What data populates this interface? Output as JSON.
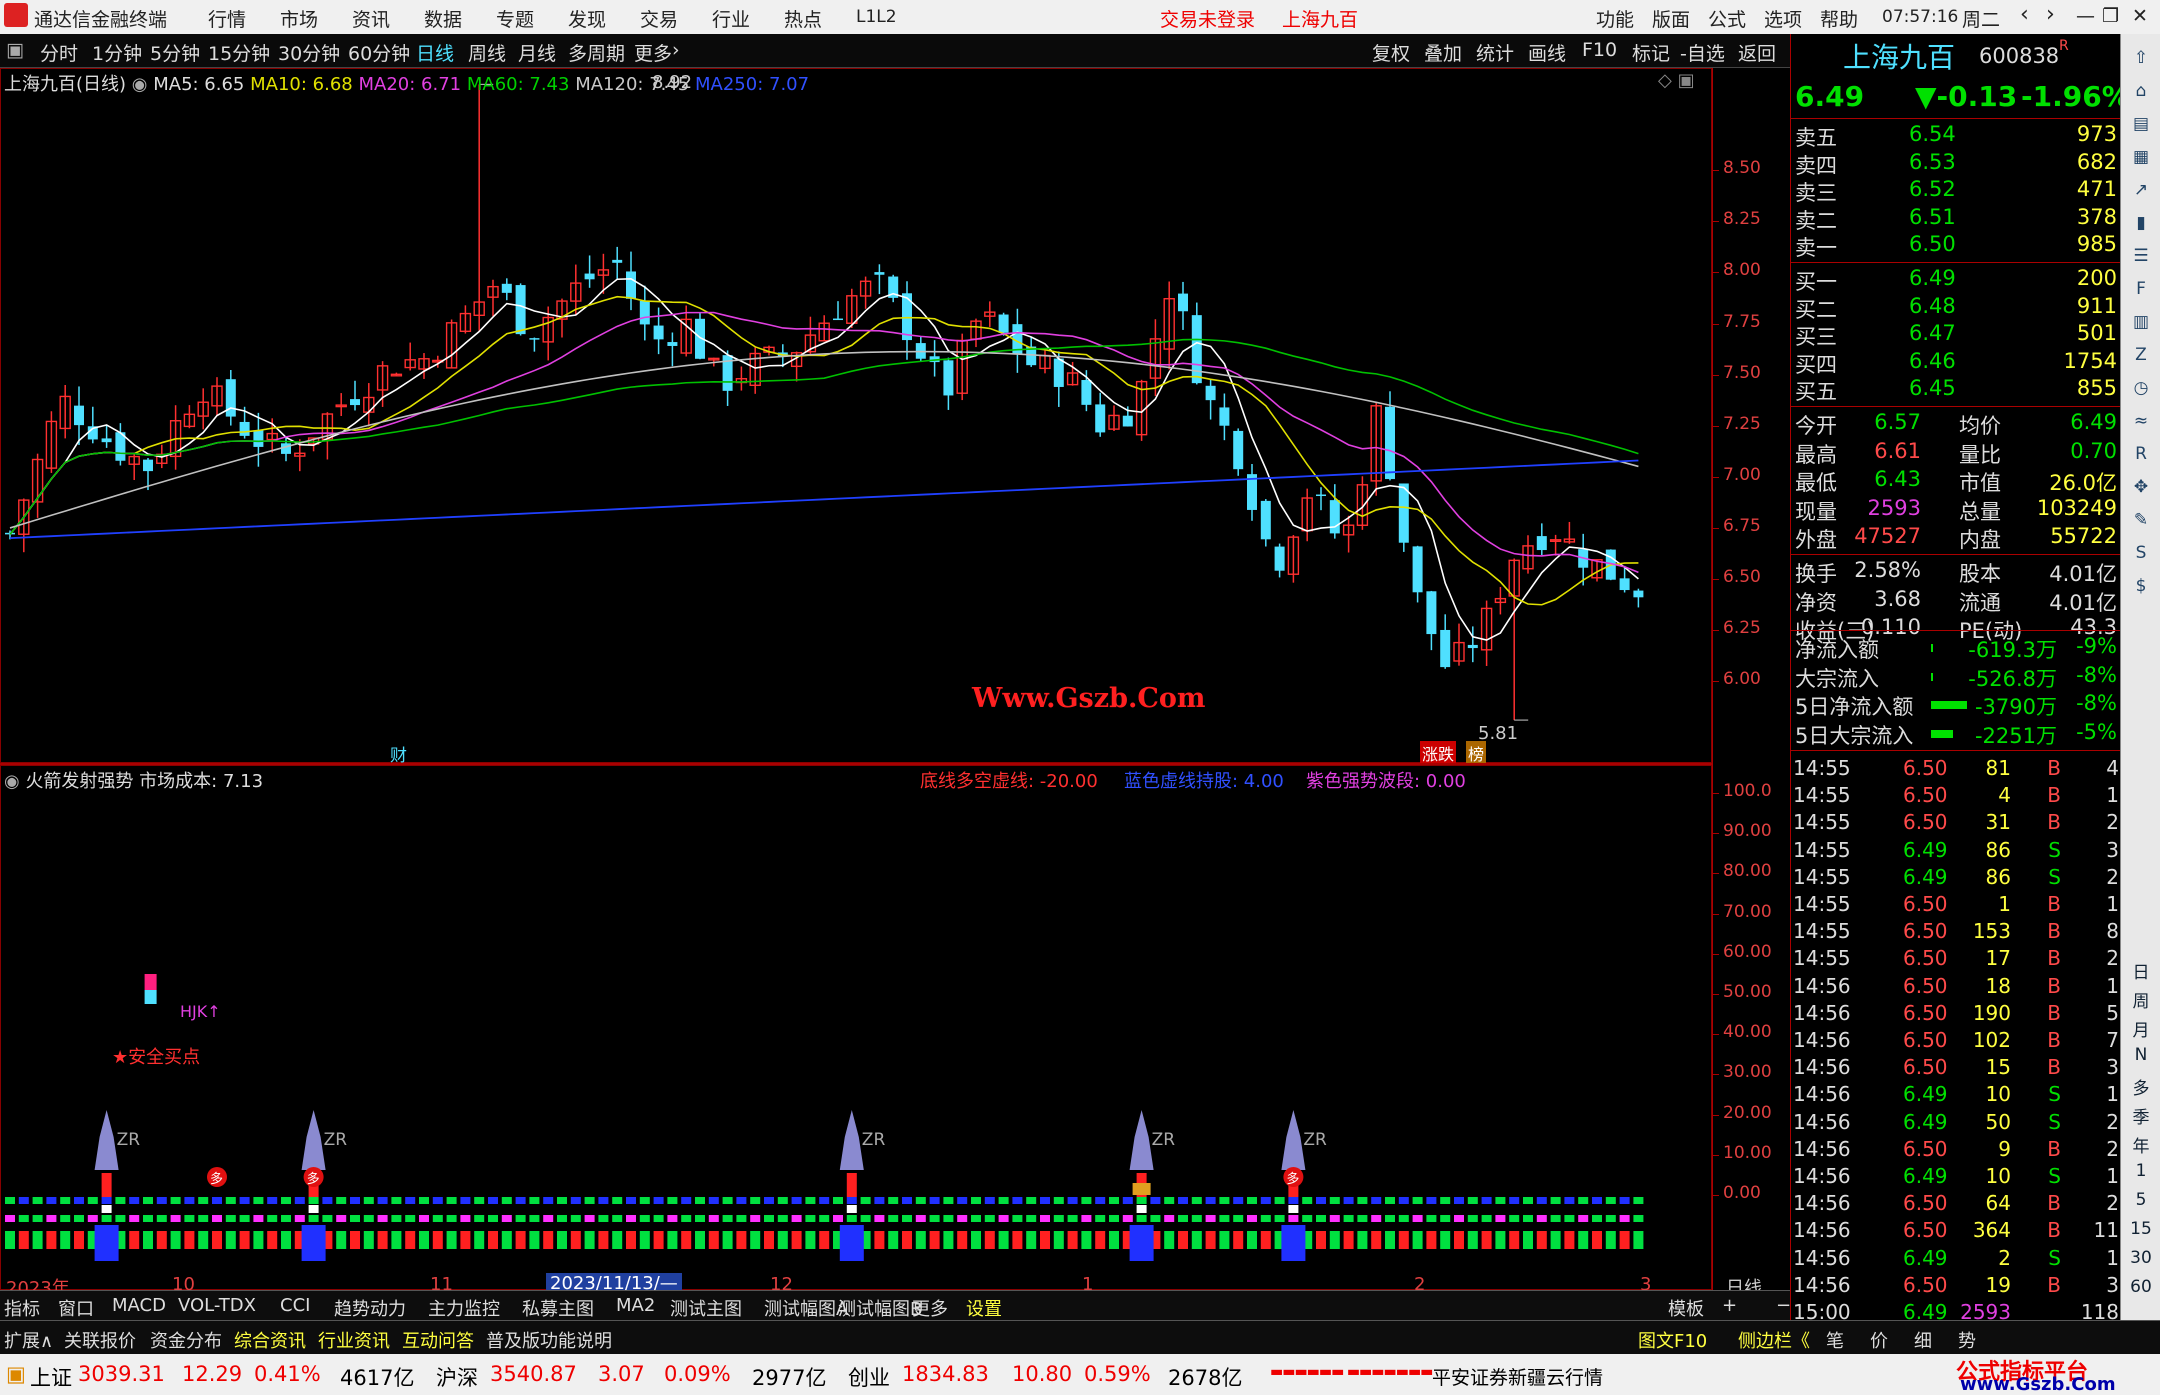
{
  "app": {
    "title": "通达信金融终端",
    "status_center": "交易未登录",
    "stock_center": "上海九百",
    "menu": [
      "行情",
      "市场",
      "资讯",
      "数据",
      "专题",
      "发现",
      "交易",
      "行业",
      "热点",
      "L1L2"
    ],
    "right_menu": [
      "功能",
      "版面",
      "公式",
      "选项",
      "帮助"
    ],
    "clock": "07:57:16",
    "weekday": "周二"
  },
  "periods": [
    "分时",
    "1分钟",
    "5分钟",
    "15分钟",
    "30分钟",
    "60分钟",
    "日线",
    "周线",
    "月线",
    "多周期",
    "更多"
  ],
  "active_period": "日线",
  "toolbar_right": [
    "复权",
    "叠加",
    "统计",
    "画线",
    "F10",
    "标记",
    "-自选",
    "返回"
  ],
  "legend": {
    "label": "上海九百(日线)",
    "ma5": "MA5: 6.65",
    "ma10": "MA10: 6.68",
    "ma20": "MA20: 6.71",
    "ma60": "MA60: 7.43",
    "ma120": "MA120: 7.45",
    "ma250": "MA250: 7.07"
  },
  "annotations": {
    "high": "8.92",
    "low": "5.81",
    "cai": "财",
    "zd": "涨跌",
    "bang": "榜",
    "watermark": "Www.Gszb.Com"
  },
  "indicator": {
    "name": "火箭发射强势",
    "cost": "市场成本: 7.13",
    "line1": "底线多空虚线: -20.00",
    "line2": "蓝色虚线持股: 4.00",
    "line3": "紫色强势波段: 0.00",
    "buy": "★安全买点",
    "kjk": "HJK↑",
    "zr": "ZR",
    "duo": "多"
  },
  "price_axis": [
    "8.50",
    "8.25",
    "8.00",
    "7.75",
    "7.50",
    "7.25",
    "7.00",
    "6.75",
    "6.50",
    "6.25",
    "6.00"
  ],
  "ind_axis": [
    "100.0",
    "90.00",
    "80.00",
    "70.00",
    "60.00",
    "50.00",
    "40.00",
    "30.00",
    "20.00",
    "10.00",
    "0.00"
  ],
  "date_axis": {
    "y2023": "2023年",
    "m10": "10",
    "m11": "11",
    "cursor": "2023/11/13/—",
    "m12": "12",
    "m1": "1",
    "m2": "2",
    "m3": "3",
    "period": "日线"
  },
  "quote": {
    "name": "上海九百",
    "code": "600838",
    "tag": "R",
    "price": "6.49",
    "change": "▼-0.13",
    "pct": "-1.96%",
    "asks": [
      [
        "卖五",
        "6.54",
        "973"
      ],
      [
        "卖四",
        "6.53",
        "682"
      ],
      [
        "卖三",
        "6.52",
        "471"
      ],
      [
        "卖二",
        "6.51",
        "378"
      ],
      [
        "卖一",
        "6.50",
        "985"
      ]
    ],
    "bids": [
      [
        "买一",
        "6.49",
        "200"
      ],
      [
        "买二",
        "6.48",
        "911"
      ],
      [
        "买三",
        "6.47",
        "501"
      ],
      [
        "买四",
        "6.46",
        "1754"
      ],
      [
        "买五",
        "6.45",
        "855"
      ]
    ],
    "stats": [
      [
        "今开",
        "6.57",
        "均价",
        "6.49"
      ],
      [
        "最高",
        "6.61",
        "量比",
        "0.70"
      ],
      [
        "最低",
        "6.43",
        "市值",
        "26.0亿"
      ],
      [
        "现量",
        "2593",
        "总量",
        "103249"
      ],
      [
        "外盘",
        "47527",
        "内盘",
        "55722"
      ]
    ],
    "stats2": [
      [
        "换手",
        "2.58%",
        "股本",
        "4.01亿"
      ],
      [
        "净资",
        "3.68",
        "流通",
        "4.01亿"
      ],
      [
        "收益(三)",
        "0.110",
        "PE(动)",
        "43.3"
      ]
    ],
    "flows": [
      [
        "净流入额",
        "-619.3万",
        "-9%"
      ],
      [
        "大宗流入",
        "-526.8万",
        "-8%"
      ],
      [
        "5日净流入额",
        "-3790万",
        "-8%"
      ],
      [
        "5日大宗流入",
        "-2251万",
        "-5%"
      ]
    ],
    "ticks": [
      [
        "14:55",
        "6.50",
        "81",
        "B",
        "4"
      ],
      [
        "14:55",
        "6.50",
        "4",
        "B",
        "1"
      ],
      [
        "14:55",
        "6.50",
        "31",
        "B",
        "2"
      ],
      [
        "14:55",
        "6.49",
        "86",
        "S",
        "3"
      ],
      [
        "14:55",
        "6.49",
        "86",
        "S",
        "2"
      ],
      [
        "14:55",
        "6.50",
        "1",
        "B",
        "1"
      ],
      [
        "14:55",
        "6.50",
        "153",
        "B",
        "8"
      ],
      [
        "14:55",
        "6.50",
        "17",
        "B",
        "2"
      ],
      [
        "14:56",
        "6.50",
        "18",
        "B",
        "1"
      ],
      [
        "14:56",
        "6.50",
        "190",
        "B",
        "5"
      ],
      [
        "14:56",
        "6.50",
        "102",
        "B",
        "7"
      ],
      [
        "14:56",
        "6.50",
        "15",
        "B",
        "3"
      ],
      [
        "14:56",
        "6.49",
        "10",
        "S",
        "1"
      ],
      [
        "14:56",
        "6.49",
        "50",
        "S",
        "2"
      ],
      [
        "14:56",
        "6.50",
        "9",
        "B",
        "2"
      ],
      [
        "14:56",
        "6.49",
        "10",
        "S",
        "1"
      ],
      [
        "14:56",
        "6.50",
        "64",
        "B",
        "2"
      ],
      [
        "14:56",
        "6.50",
        "364",
        "B",
        "11"
      ],
      [
        "14:56",
        "6.49",
        "2",
        "S",
        "1"
      ],
      [
        "14:56",
        "6.50",
        "19",
        "B",
        "3"
      ],
      [
        "15:00",
        "6.49",
        "2593",
        "",
        "118"
      ]
    ]
  },
  "bottom_tabs": [
    "指标",
    "窗口",
    "MACD",
    "VOL-TDX",
    "CCI",
    "趋势动力",
    "主力监控",
    "私募主图",
    "MA2",
    "测试主图",
    "测试幅图A",
    "测试幅图B",
    "更多",
    "设置"
  ],
  "bottom_right": [
    "模板",
    "+",
    "−"
  ],
  "bottom_tabs2": [
    "扩展∧",
    "关联报价",
    "资金分布",
    "综合资讯",
    "行业资讯",
    "互动问答",
    "普及版功能说明"
  ],
  "bottom2_right": [
    "图文F10",
    "侧边栏《",
    "笔",
    "价",
    "细",
    "势"
  ],
  "statusbar": {
    "sh_label": "上证",
    "sh": "3039.31",
    "sh_chg": "12.29",
    "sh_pct": "0.41%",
    "sh_amt": "4617亿",
    "hs_label": "沪深",
    "hs": "3540.87",
    "hs_chg": "3.07",
    "hs_pct": "0.09%",
    "hs_amt": "2977亿",
    "cy_label": "创业",
    "cy": "1834.83",
    "cy_chg": "10.80",
    "cy_pct": "0.59%",
    "cy_amt": "2678亿",
    "broker": "平安证券新疆云行情",
    "brand": "公式指标平台",
    "brand_url": "www.Gszb.Com"
  },
  "sidebar": [
    "日",
    "周",
    "月",
    "N",
    "多",
    "季",
    "年",
    "1",
    "5",
    "15",
    "30",
    "60"
  ],
  "chart_data": {
    "type": "candlestick",
    "y_range": [
      5.6,
      9.0
    ],
    "ma_colors": {
      "ma5": "#ffffff",
      "ma10": "#e0e000",
      "ma20": "#e040e0",
      "ma60": "#00c000",
      "ma120": "#c0c0c0",
      "ma250": "#2040ff"
    }
  }
}
